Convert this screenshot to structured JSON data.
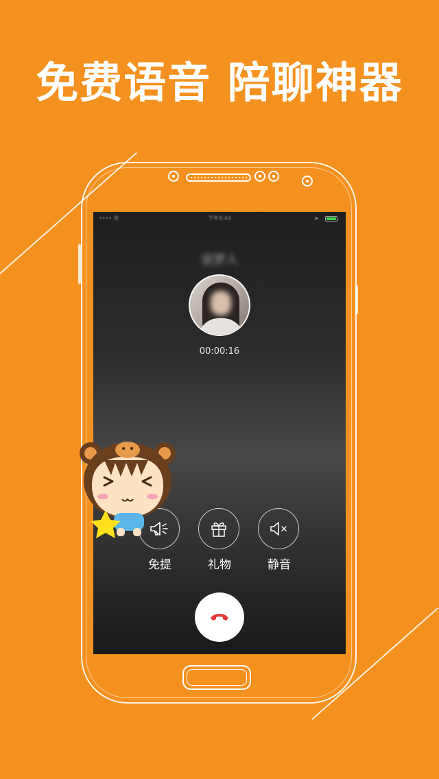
{
  "headline": "免费语音 陪聊神器",
  "call_screen": {
    "status_left": "•••• 令",
    "status_time": "下午9:44",
    "caller_name": "说梦人",
    "timer": "00:00:16",
    "controls": [
      {
        "label": "免提",
        "icon": "speaker-icon"
      },
      {
        "label": "礼物",
        "icon": "gift-icon"
      },
      {
        "label": "静音",
        "icon": "mute-icon"
      }
    ],
    "hangup_icon": "hangup-phone-icon"
  },
  "colors": {
    "background": "#f5911f",
    "hangup_red": "#e53935",
    "battery_green": "#3bd34b"
  }
}
